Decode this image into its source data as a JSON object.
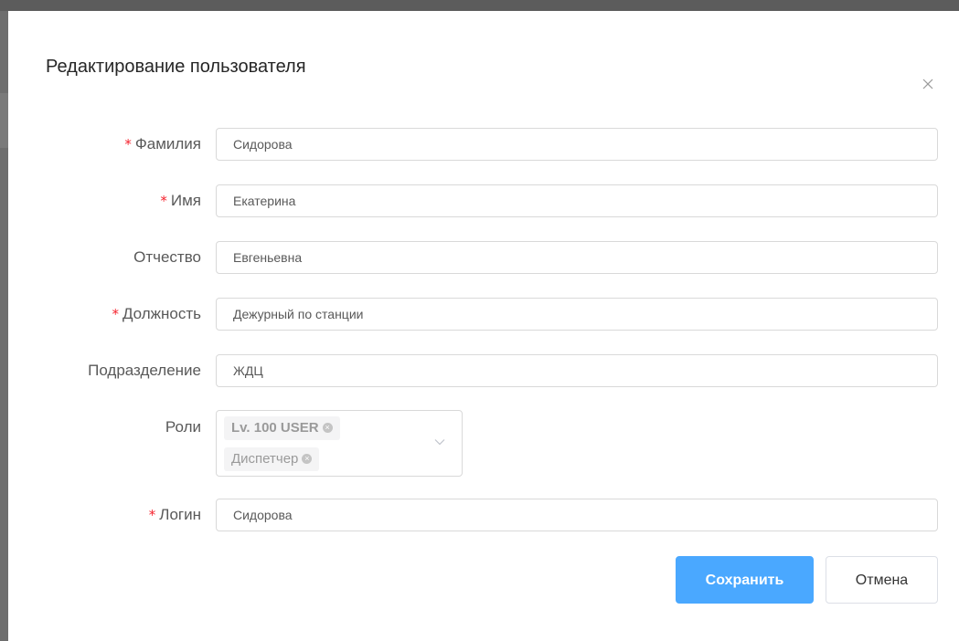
{
  "dialog": {
    "title": "Редактирование пользователя"
  },
  "form": {
    "last_name": {
      "label": "Фамилия",
      "required": true,
      "value": "Сидорова"
    },
    "first_name": {
      "label": "Имя",
      "required": true,
      "value": "Екатерина"
    },
    "patronymic": {
      "label": "Отчество",
      "required": false,
      "value": "Евгеньевна"
    },
    "position": {
      "label": "Должность",
      "required": true,
      "value": "Дежурный по станции"
    },
    "department": {
      "label": "Подразделение",
      "required": false,
      "value": "ЖДЦ"
    },
    "roles": {
      "label": "Роли",
      "required": false,
      "selected": [
        "Lv. 100 USER",
        "Диспетчер"
      ]
    },
    "login": {
      "label": "Логин",
      "required": true,
      "value": "Сидорова"
    }
  },
  "buttons": {
    "save": "Сохранить",
    "cancel": "Отмена"
  },
  "required_mark": "*",
  "colors": {
    "primary": "#4aa8ff",
    "required": "#f5222d"
  },
  "icons": {
    "close": "close-icon",
    "chevron": "chevron-down-icon",
    "tag_remove": "tag-remove-icon"
  }
}
